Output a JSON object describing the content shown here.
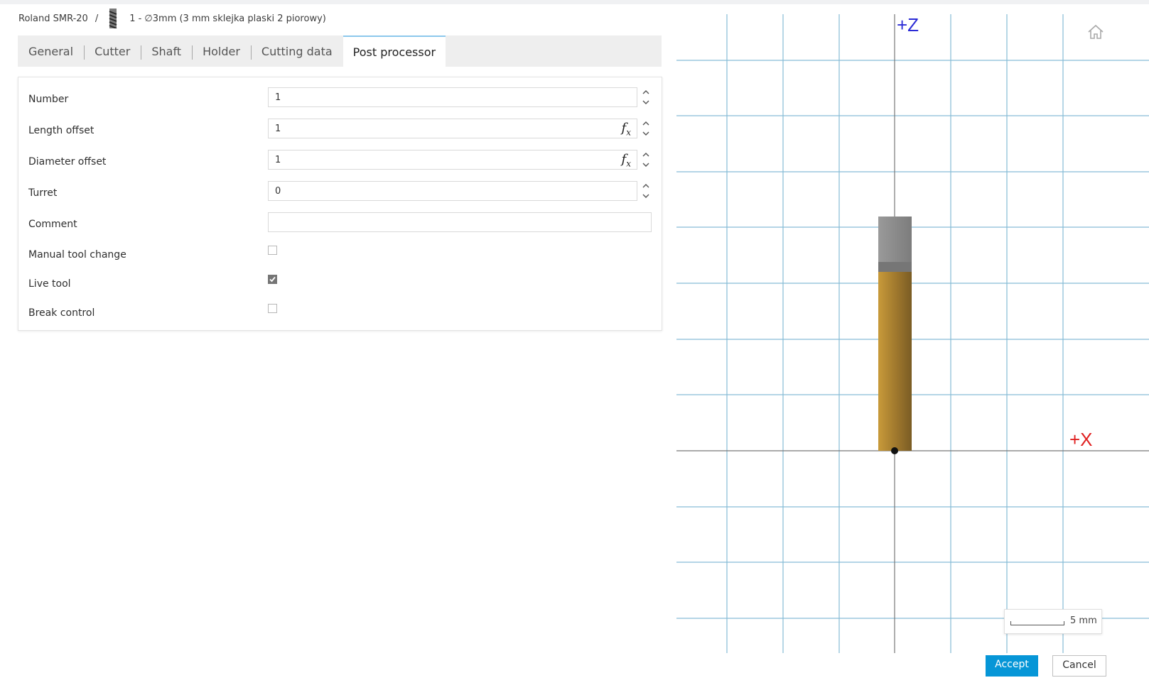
{
  "breadcrumb": {
    "machine": "Roland SMR-20",
    "separator": "/",
    "tool": "1 - ∅3mm (3 mm sklejka plaski 2 piorowy)"
  },
  "tabs": [
    {
      "label": "General"
    },
    {
      "label": "Cutter"
    },
    {
      "label": "Shaft"
    },
    {
      "label": "Holder"
    },
    {
      "label": "Cutting data"
    },
    {
      "label": "Post processor",
      "active": true
    }
  ],
  "form": {
    "number": {
      "label": "Number",
      "value": "1"
    },
    "length_offset": {
      "label": "Length offset",
      "value": "1"
    },
    "diameter_offset": {
      "label": "Diameter offset",
      "value": "1"
    },
    "turret": {
      "label": "Turret",
      "value": "0"
    },
    "comment": {
      "label": "Comment",
      "value": ""
    },
    "manual_tool_change": {
      "label": "Manual tool change",
      "checked": false
    },
    "live_tool": {
      "label": "Live tool",
      "checked": true
    },
    "break_control": {
      "label": "Break control",
      "checked": false
    },
    "fx_symbol": "f",
    "fx_sub": "x"
  },
  "viewer": {
    "axis_z": "+Z",
    "axis_x": "+X",
    "scale_label": "5 mm",
    "z_color": "#2b2bd6",
    "x_color": "#e02020",
    "grid_color": "#86bcd6"
  },
  "buttons": {
    "accept": "Accept",
    "cancel": "Cancel"
  },
  "icons": {
    "tool": "end-mill-icon",
    "home": "home-icon",
    "stepper": "up-down-chevron-icon",
    "check": "checkmark-icon"
  }
}
